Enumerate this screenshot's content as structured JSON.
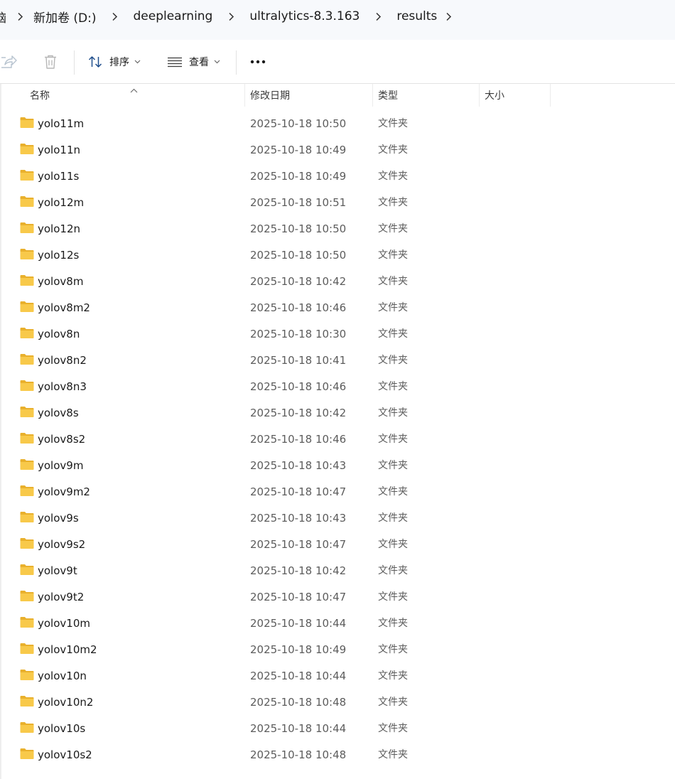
{
  "breadcrumb": {
    "items": [
      "脑",
      "新加卷 (D:)",
      "deeplearning",
      "ultralytics-8.3.163",
      "results"
    ]
  },
  "toolbar": {
    "sort_label": "排序",
    "view_label": "查看",
    "more_label": "•••"
  },
  "columns": {
    "name": "名称",
    "modified": "修改日期",
    "type": "类型",
    "size": "大小"
  },
  "files": [
    {
      "name": "yolo11m",
      "modified": "2025-10-18 10:50",
      "type": "文件夹"
    },
    {
      "name": "yolo11n",
      "modified": "2025-10-18 10:49",
      "type": "文件夹"
    },
    {
      "name": "yolo11s",
      "modified": "2025-10-18 10:49",
      "type": "文件夹"
    },
    {
      "name": "yolo12m",
      "modified": "2025-10-18 10:51",
      "type": "文件夹"
    },
    {
      "name": "yolo12n",
      "modified": "2025-10-18 10:50",
      "type": "文件夹"
    },
    {
      "name": "yolo12s",
      "modified": "2025-10-18 10:50",
      "type": "文件夹"
    },
    {
      "name": "yolov8m",
      "modified": "2025-10-18 10:42",
      "type": "文件夹"
    },
    {
      "name": "yolov8m2",
      "modified": "2025-10-18 10:46",
      "type": "文件夹"
    },
    {
      "name": "yolov8n",
      "modified": "2025-10-18 10:30",
      "type": "文件夹"
    },
    {
      "name": "yolov8n2",
      "modified": "2025-10-18 10:41",
      "type": "文件夹"
    },
    {
      "name": "yolov8n3",
      "modified": "2025-10-18 10:46",
      "type": "文件夹"
    },
    {
      "name": "yolov8s",
      "modified": "2025-10-18 10:42",
      "type": "文件夹"
    },
    {
      "name": "yolov8s2",
      "modified": "2025-10-18 10:46",
      "type": "文件夹"
    },
    {
      "name": "yolov9m",
      "modified": "2025-10-18 10:43",
      "type": "文件夹"
    },
    {
      "name": "yolov9m2",
      "modified": "2025-10-18 10:47",
      "type": "文件夹"
    },
    {
      "name": "yolov9s",
      "modified": "2025-10-18 10:43",
      "type": "文件夹"
    },
    {
      "name": "yolov9s2",
      "modified": "2025-10-18 10:47",
      "type": "文件夹"
    },
    {
      "name": "yolov9t",
      "modified": "2025-10-18 10:42",
      "type": "文件夹"
    },
    {
      "name": "yolov9t2",
      "modified": "2025-10-18 10:47",
      "type": "文件夹"
    },
    {
      "name": "yolov10m",
      "modified": "2025-10-18 10:44",
      "type": "文件夹"
    },
    {
      "name": "yolov10m2",
      "modified": "2025-10-18 10:49",
      "type": "文件夹"
    },
    {
      "name": "yolov10n",
      "modified": "2025-10-18 10:44",
      "type": "文件夹"
    },
    {
      "name": "yolov10n2",
      "modified": "2025-10-18 10:48",
      "type": "文件夹"
    },
    {
      "name": "yolov10s",
      "modified": "2025-10-18 10:44",
      "type": "文件夹"
    },
    {
      "name": "yolov10s2",
      "modified": "2025-10-18 10:48",
      "type": "文件夹"
    }
  ],
  "colors": {
    "folder_fill": "#f8c94a",
    "folder_tab": "#e9b02c",
    "accent": "#0067c0",
    "date_text": "#5c5c5c"
  },
  "icons": {
    "share": "share-icon",
    "delete": "trash-icon",
    "sort": "sort-icon",
    "view": "view-lines-icon",
    "folder": "folder-icon"
  }
}
